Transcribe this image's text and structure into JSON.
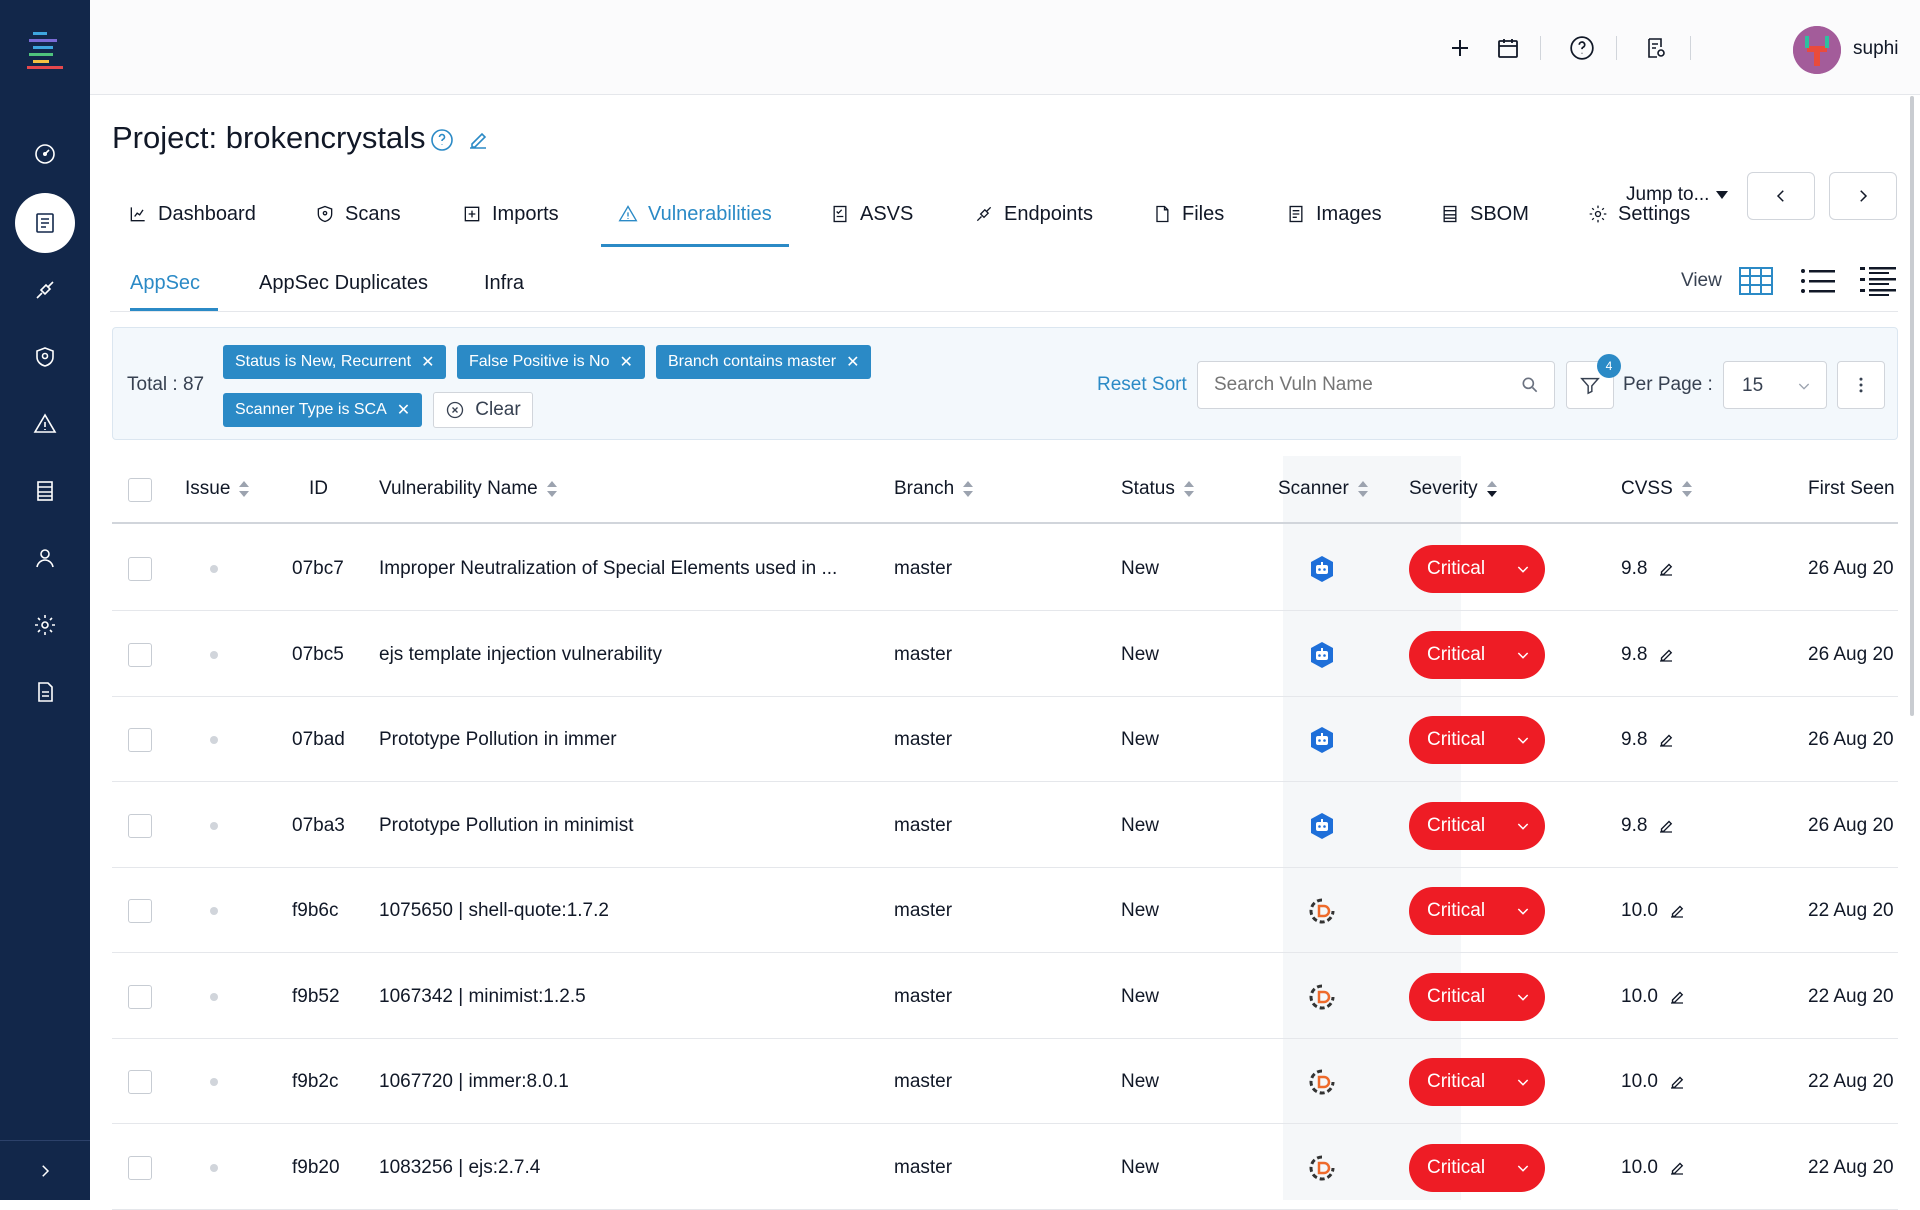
{
  "topbar": {
    "username": "suphi"
  },
  "project": {
    "title": "Project: brokencrystals"
  },
  "tabs": [
    {
      "label": "Dashboard"
    },
    {
      "label": "Scans"
    },
    {
      "label": "Imports"
    },
    {
      "label": "Vulnerabilities"
    },
    {
      "label": "ASVS"
    },
    {
      "label": "Endpoints"
    },
    {
      "label": "Files"
    },
    {
      "label": "Images"
    },
    {
      "label": "SBOM"
    },
    {
      "label": "Settings"
    }
  ],
  "jump_to": "Jump to...",
  "subtabs": [
    {
      "label": "AppSec"
    },
    {
      "label": "AppSec Duplicates"
    },
    {
      "label": "Infra"
    }
  ],
  "view_label": "View",
  "filters": {
    "total": "Total : 87",
    "chips": [
      "Status is New, Recurrent",
      "False Positive is No",
      "Branch contains master",
      "Scanner Type is SCA"
    ],
    "clear_label": "Clear",
    "reset_sort": "Reset Sort",
    "search_placeholder": "Search Vuln Name",
    "filter_count": "4",
    "per_page_label": "Per Page :",
    "per_page_value": "15"
  },
  "table": {
    "columns": [
      "Issue",
      "ID",
      "Vulnerability Name",
      "Branch",
      "Status",
      "Scanner",
      "Severity",
      "CVSS",
      "First Seen"
    ],
    "rows": [
      {
        "id": "07bc7",
        "name": "Improper Neutralization of Special Elements used in ...",
        "branch": "master",
        "status": "New",
        "scanner": "robot-icon",
        "severity": "Critical",
        "cvss": "9.8",
        "first_seen": "26 Aug 20"
      },
      {
        "id": "07bc5",
        "name": "ejs template injection vulnerability",
        "branch": "master",
        "status": "New",
        "scanner": "robot-icon",
        "severity": "Critical",
        "cvss": "9.8",
        "first_seen": "26 Aug 20"
      },
      {
        "id": "07bad",
        "name": "Prototype Pollution in immer",
        "branch": "master",
        "status": "New",
        "scanner": "robot-icon",
        "severity": "Critical",
        "cvss": "9.8",
        "first_seen": "26 Aug 20"
      },
      {
        "id": "07ba3",
        "name": "Prototype Pollution in minimist",
        "branch": "master",
        "status": "New",
        "scanner": "robot-icon",
        "severity": "Critical",
        "cvss": "9.8",
        "first_seen": "26 Aug 20"
      },
      {
        "id": "f9b6c",
        "name": "1075650 | shell-quote:1.7.2",
        "branch": "master",
        "status": "New",
        "scanner": "depcheck-icon",
        "severity": "Critical",
        "cvss": "10.0",
        "first_seen": "22 Aug 20"
      },
      {
        "id": "f9b52",
        "name": "1067342 | minimist:1.2.5",
        "branch": "master",
        "status": "New",
        "scanner": "depcheck-icon",
        "severity": "Critical",
        "cvss": "10.0",
        "first_seen": "22 Aug 20"
      },
      {
        "id": "f9b2c",
        "name": "1067720 | immer:8.0.1",
        "branch": "master",
        "status": "New",
        "scanner": "depcheck-icon",
        "severity": "Critical",
        "cvss": "10.0",
        "first_seen": "22 Aug 20"
      },
      {
        "id": "f9b20",
        "name": "1083256 | ejs:2.7.4",
        "branch": "master",
        "status": "New",
        "scanner": "depcheck-icon",
        "severity": "Critical",
        "cvss": "10.0",
        "first_seen": "22 Aug 20"
      }
    ]
  },
  "colors": {
    "accent": "#2b8ac6",
    "sidebar": "#12274a",
    "critical": "#ee1c25"
  }
}
